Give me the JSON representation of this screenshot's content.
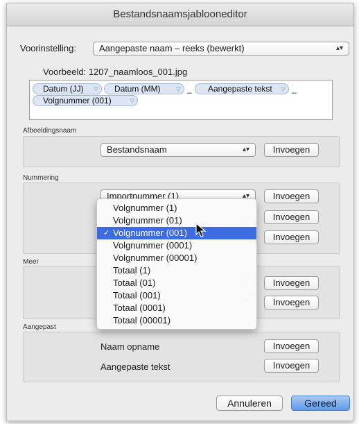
{
  "window": {
    "title": "Bestandsnaamsjablooneditor"
  },
  "preset": {
    "label": "Voorinstelling:",
    "value": "Aangepaste naam – reeks (bewerkt)"
  },
  "example": {
    "label": "Voorbeeld:",
    "value": "1207_naamloos_001.jpg"
  },
  "template": {
    "tokens": [
      "Datum (JJ)",
      "Datum (MM)",
      "Aangepaste tekst",
      "Volgnummer (001)"
    ],
    "separators": [
      "_",
      "_"
    ]
  },
  "image_name": {
    "section_label": "Afbeeldingsnaam",
    "popup_value": "Bestandsnaam",
    "insert_label": "Invoegen"
  },
  "numbering": {
    "section_label": "Nummering",
    "popup_partial_value": "Importnummer (1)",
    "insert_labels": [
      "Invoegen",
      "Invoegen",
      "Invoegen"
    ]
  },
  "more": {
    "section_label": "Meer",
    "insert_labels": [
      "Invoegen",
      "Invoegen"
    ]
  },
  "custom": {
    "section_label": "Aangepast",
    "rows": [
      {
        "label": "Naam opname",
        "insert_label": "Invoegen"
      },
      {
        "label": "Aangepaste tekst",
        "insert_label": "Invoegen"
      }
    ]
  },
  "menu": {
    "items": [
      "Volgnummer (1)",
      "Volgnummer (01)",
      "Volgnummer (001)",
      "Volgnummer (0001)",
      "Volgnummer (00001)",
      "Totaal (1)",
      "Totaal (01)",
      "Totaal (001)",
      "Totaal (0001)",
      "Totaal (00001)"
    ],
    "selected_index": 2,
    "check_mark": "✓"
  },
  "footer": {
    "cancel_label": "Annuleren",
    "done_label": "Gereed"
  },
  "colors": {
    "accent": "#3d6ce0",
    "token_fill": "#dde6f5"
  }
}
